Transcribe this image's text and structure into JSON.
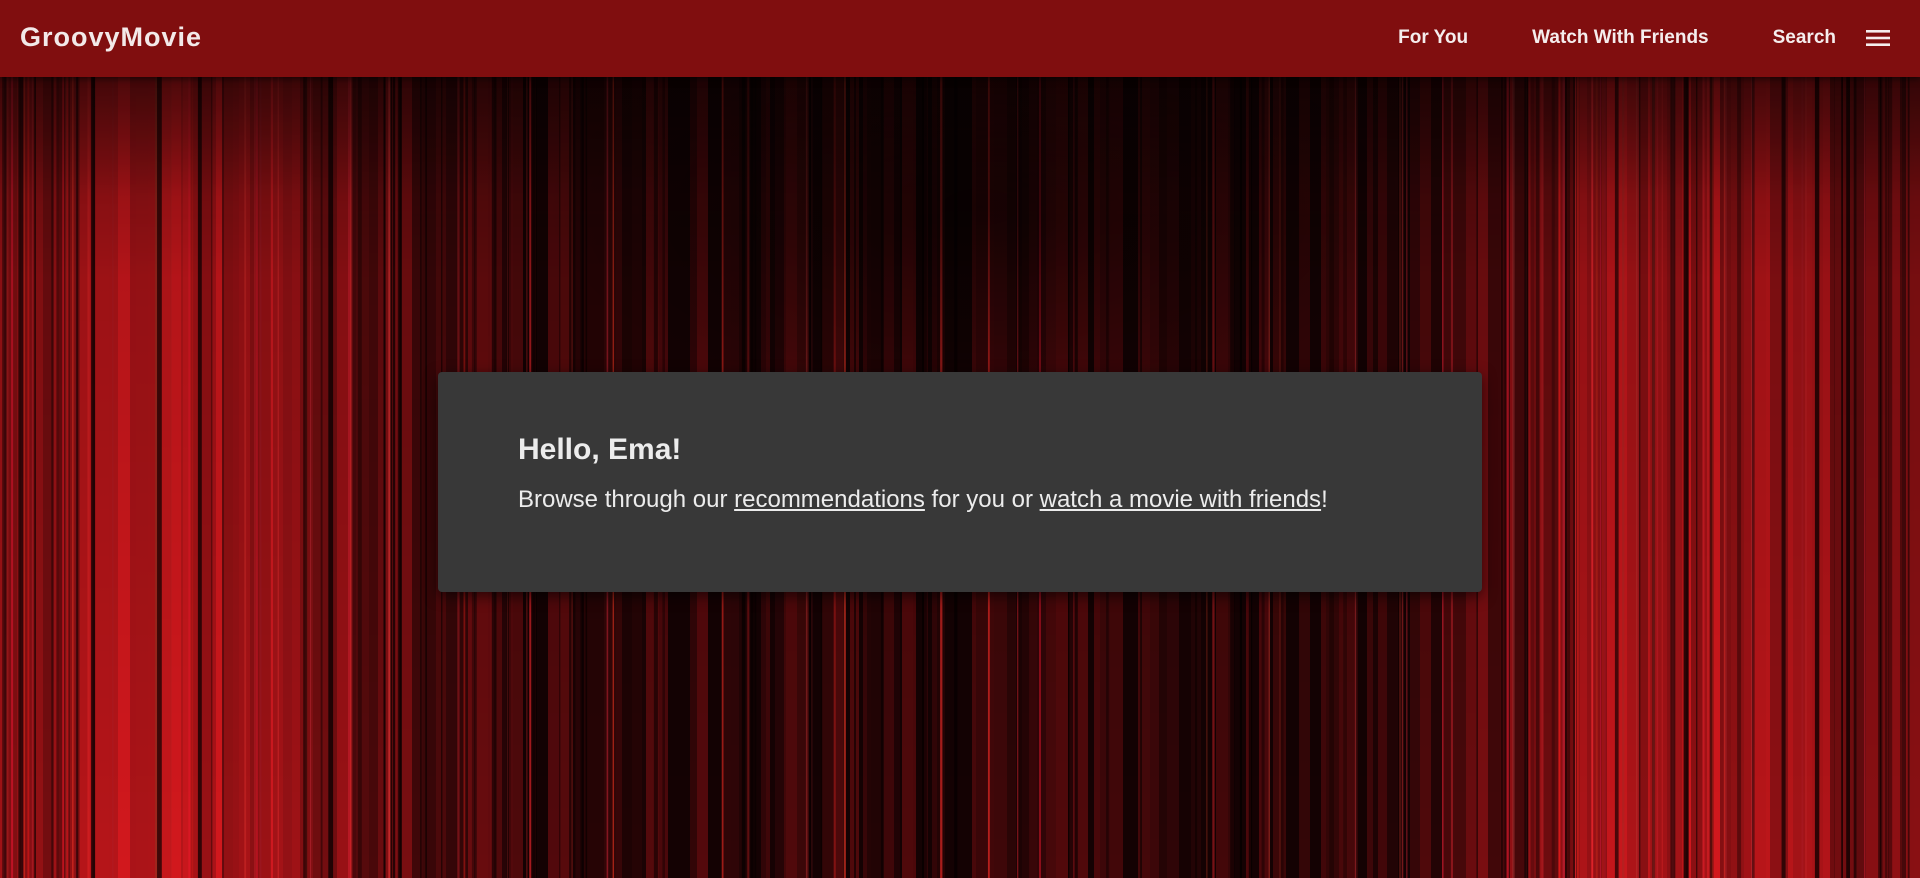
{
  "header": {
    "brand": "GroovyMovie",
    "nav": [
      {
        "label": "For You"
      },
      {
        "label": "Watch With Friends"
      },
      {
        "label": "Search"
      }
    ],
    "menu_icon": "hamburger-menu-icon"
  },
  "welcome": {
    "greeting": "Hello, Ema!",
    "text_before": "Browse through our ",
    "link_recommendations": "recommendations",
    "text_middle": " for you or ",
    "link_watch": "watch a movie with friends",
    "text_after": "!"
  },
  "colors": {
    "navbar": "#800e0f",
    "card": "#383838",
    "curtain_red": "#c8141a",
    "text": "#ececec"
  }
}
